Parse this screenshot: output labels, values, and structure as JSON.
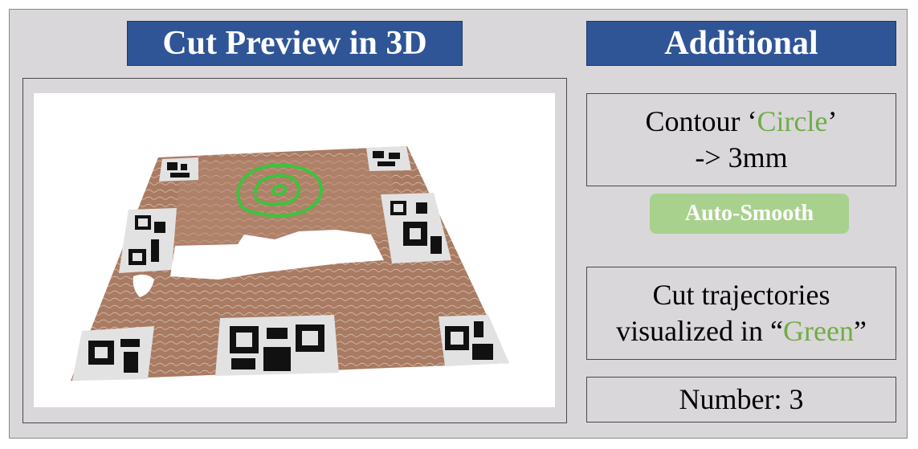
{
  "header": {
    "left_title": "Cut Preview in 3D",
    "right_title": "Additional"
  },
  "contour": {
    "prefix": "Contour ‘",
    "name": "Circle",
    "suffix": "’",
    "offset": "-> 3mm"
  },
  "auto_smooth": {
    "label": "Auto-Smooth"
  },
  "trajectories": {
    "line1": "Cut trajectories",
    "line2_prefix": "visualized in “",
    "color_name": "Green",
    "line2_suffix": "”"
  },
  "number": {
    "label": "Number: 3"
  },
  "colors": {
    "title_bar": "#2f5597",
    "panel_bg": "#d9d7d9",
    "highlight_green": "#70ad47",
    "button_green": "#a9d18e",
    "trajectory_green": "#3cc43c",
    "surface_brown": "#a97b62"
  }
}
